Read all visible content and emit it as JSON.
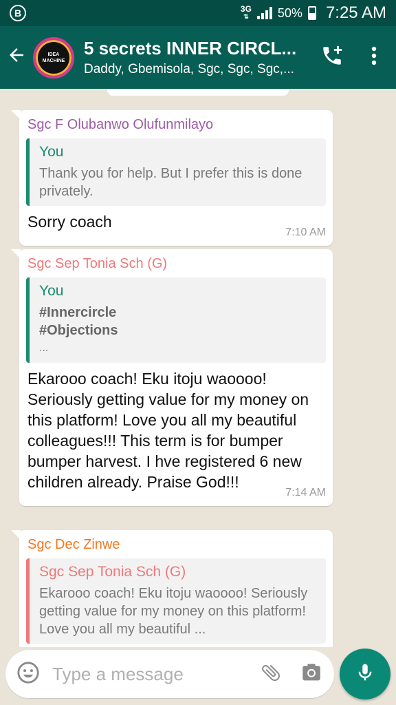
{
  "status_bar": {
    "network": "3G",
    "battery": "50%",
    "time": "7:25 AM",
    "business_badge": "B"
  },
  "header": {
    "title": "5 secrets INNER CIRCL...",
    "subtitle": "Daddy, Gbemisola, Sgc, Sgc, Sgc,...",
    "avatar_text": "IDEA MACHINE"
  },
  "messages": [
    {
      "sender": "Sgc F Olubanwo Olufunmilayo",
      "sender_color": "#9c5ca6",
      "quote_author": "You",
      "quote_text": "Thank you for help. But I prefer this is done privately.",
      "text": "Sorry coach",
      "time": "7:10 AM"
    },
    {
      "sender": "Sgc Sep Tonia Sch (G)",
      "sender_color": "#f07878",
      "quote_author": "You",
      "quote_lines": [
        "#Innercircle",
        "#Objections",
        "..."
      ],
      "text": "Ekarooo coach! Eku itoju waoooo! Seriously getting value for my money on this platform! Love you all my beautiful colleagues!!! This term is for bumper bumper harvest. I hve registered 6 new children already. Praise God!!!",
      "time": "7:14 AM"
    },
    {
      "sender": "Sgc Dec Zinwe",
      "sender_color": "#f07a22",
      "quote_author": "Sgc Sep Tonia Sch (G)",
      "quote_author_color": "#f07878",
      "quote_text": "Ekarooo coach! Eku itoju waoooo! Seriously getting value for my money on this platform! Love you all my beautiful ..."
    }
  ],
  "composer": {
    "placeholder": "Type a message"
  },
  "colors": {
    "status_bar": "#054d44",
    "app_bar": "#075e54",
    "accent": "#0a8a76"
  }
}
